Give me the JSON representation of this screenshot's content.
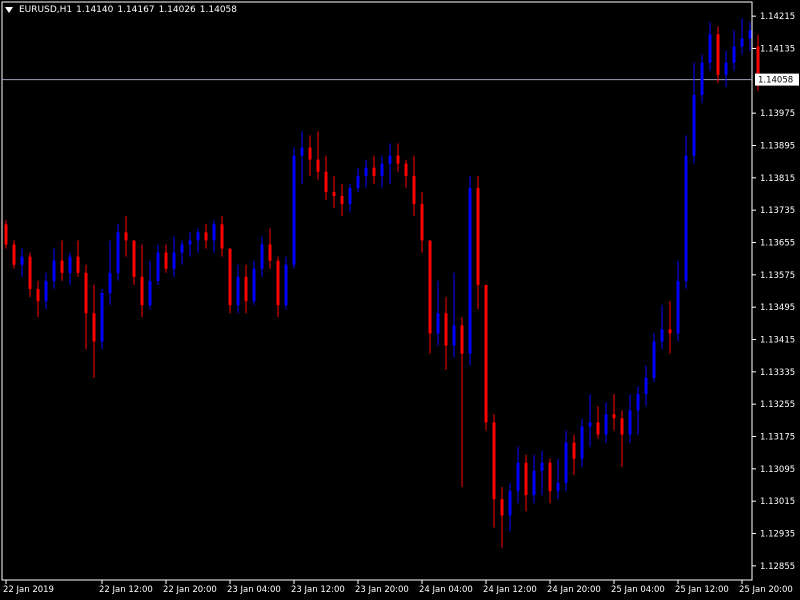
{
  "header": {
    "symbol": "EURUSD,H1",
    "open": "1.14140",
    "high": "1.14167",
    "low": "1.14026",
    "close": "1.14058"
  },
  "colors": {
    "background": "#000000",
    "bull": "#0000ff",
    "bear": "#ff0000",
    "axis": "#ffffff",
    "current_line": "#a0a0c0"
  },
  "chart_data": {
    "type": "candlestick",
    "symbol": "EURUSD",
    "timeframe": "H1",
    "ylim": [
      1.1282,
      1.1425
    ],
    "yticks": [
      "1.14215",
      "1.14135",
      "1.14058",
      "1.13975",
      "1.13895",
      "1.13815",
      "1.13735",
      "1.13655",
      "1.13575",
      "1.13495",
      "1.13415",
      "1.13335",
      "1.13255",
      "1.13175",
      "1.13095",
      "1.13015",
      "1.12935",
      "1.12855"
    ],
    "current_price": "1.14058",
    "xticks": [
      {
        "label": "22 Jan 2019",
        "index": 0
      },
      {
        "label": "22 Jan 12:00",
        "index": 12
      },
      {
        "label": "22 Jan 20:00",
        "index": 20
      },
      {
        "label": "23 Jan 04:00",
        "index": 28
      },
      {
        "label": "23 Jan 12:00",
        "index": 36
      },
      {
        "label": "23 Jan 20:00",
        "index": 44
      },
      {
        "label": "24 Jan 04:00",
        "index": 52
      },
      {
        "label": "24 Jan 12:00",
        "index": 60
      },
      {
        "label": "24 Jan 20:00",
        "index": 68
      },
      {
        "label": "25 Jan 04:00",
        "index": 76
      },
      {
        "label": "25 Jan 12:00",
        "index": 84
      },
      {
        "label": "25 Jan 20:00",
        "index": 92
      }
    ],
    "candles": [
      [
        1.137,
        1.1371,
        1.1364,
        1.1365
      ],
      [
        1.1365,
        1.1366,
        1.1359,
        1.136
      ],
      [
        1.136,
        1.1364,
        1.1357,
        1.1362
      ],
      [
        1.1362,
        1.1363,
        1.1352,
        1.1354
      ],
      [
        1.1354,
        1.1356,
        1.1347,
        1.1351
      ],
      [
        1.1351,
        1.1358,
        1.1349,
        1.1356
      ],
      [
        1.1356,
        1.1364,
        1.1354,
        1.1361
      ],
      [
        1.1361,
        1.1366,
        1.1356,
        1.1358
      ],
      [
        1.1358,
        1.1363,
        1.1355,
        1.1362
      ],
      [
        1.1362,
        1.1366,
        1.1357,
        1.1358
      ],
      [
        1.1358,
        1.136,
        1.1339,
        1.1348
      ],
      [
        1.1348,
        1.1355,
        1.1332,
        1.1341
      ],
      [
        1.1341,
        1.1354,
        1.1339,
        1.1353
      ],
      [
        1.1353,
        1.1366,
        1.135,
        1.1358
      ],
      [
        1.1358,
        1.137,
        1.1356,
        1.1368
      ],
      [
        1.1368,
        1.1372,
        1.1362,
        1.1366
      ],
      [
        1.1366,
        1.1366,
        1.1355,
        1.1357
      ],
      [
        1.1357,
        1.1365,
        1.1347,
        1.135
      ],
      [
        1.135,
        1.1361,
        1.1349,
        1.1356
      ],
      [
        1.1356,
        1.1365,
        1.1355,
        1.1363
      ],
      [
        1.1363,
        1.1365,
        1.1358,
        1.1359
      ],
      [
        1.1359,
        1.1367,
        1.1357,
        1.1363
      ],
      [
        1.1363,
        1.1366,
        1.136,
        1.1365
      ],
      [
        1.1365,
        1.1368,
        1.1362,
        1.1366
      ],
      [
        1.1366,
        1.1369,
        1.1363,
        1.1368
      ],
      [
        1.1368,
        1.137,
        1.1364,
        1.1366
      ],
      [
        1.1366,
        1.1371,
        1.1363,
        1.137
      ],
      [
        1.137,
        1.1372,
        1.1362,
        1.1364
      ],
      [
        1.1364,
        1.1364,
        1.1348,
        1.135
      ],
      [
        1.135,
        1.136,
        1.1348,
        1.1357
      ],
      [
        1.1357,
        1.136,
        1.1348,
        1.1351
      ],
      [
        1.1351,
        1.1361,
        1.135,
        1.1359
      ],
      [
        1.1359,
        1.1367,
        1.1357,
        1.1365
      ],
      [
        1.1365,
        1.1369,
        1.1359,
        1.1361
      ],
      [
        1.1361,
        1.1362,
        1.1347,
        1.135
      ],
      [
        1.135,
        1.1362,
        1.1349,
        1.136
      ],
      [
        1.136,
        1.1389,
        1.1359,
        1.1387
      ],
      [
        1.1387,
        1.1393,
        1.138,
        1.1389
      ],
      [
        1.1389,
        1.1392,
        1.1382,
        1.1386
      ],
      [
        1.1386,
        1.1393,
        1.1381,
        1.1383
      ],
      [
        1.1383,
        1.1387,
        1.1376,
        1.1378
      ],
      [
        1.1378,
        1.1382,
        1.1374,
        1.1377
      ],
      [
        1.1377,
        1.138,
        1.1372,
        1.1375
      ],
      [
        1.1375,
        1.138,
        1.1373,
        1.1379
      ],
      [
        1.1379,
        1.1384,
        1.1378,
        1.1382
      ],
      [
        1.1382,
        1.1386,
        1.1379,
        1.1384
      ],
      [
        1.1384,
        1.1387,
        1.138,
        1.1382
      ],
      [
        1.1382,
        1.1387,
        1.1379,
        1.1385
      ],
      [
        1.1385,
        1.139,
        1.138,
        1.1387
      ],
      [
        1.1387,
        1.139,
        1.1383,
        1.1385
      ],
      [
        1.1385,
        1.1386,
        1.1379,
        1.1382
      ],
      [
        1.1382,
        1.1387,
        1.1372,
        1.1375
      ],
      [
        1.1375,
        1.1378,
        1.1363,
        1.1366
      ],
      [
        1.1366,
        1.1366,
        1.1338,
        1.1343
      ],
      [
        1.1343,
        1.1356,
        1.134,
        1.1348
      ],
      [
        1.1348,
        1.1352,
        1.1334,
        1.134
      ],
      [
        1.134,
        1.1358,
        1.1337,
        1.1345
      ],
      [
        1.1345,
        1.1347,
        1.1305,
        1.1338
      ],
      [
        1.1338,
        1.1382,
        1.1335,
        1.1379
      ],
      [
        1.1379,
        1.1382,
        1.1349,
        1.1355
      ],
      [
        1.1355,
        1.1355,
        1.1319,
        1.1321
      ],
      [
        1.1321,
        1.1323,
        1.1295,
        1.1302
      ],
      [
        1.1302,
        1.1305,
        1.129,
        1.1298
      ],
      [
        1.1298,
        1.1306,
        1.1294,
        1.1304
      ],
      [
        1.1304,
        1.1315,
        1.1301,
        1.1311
      ],
      [
        1.1311,
        1.1313,
        1.1299,
        1.1303
      ],
      [
        1.1303,
        1.1313,
        1.1301,
        1.1309
      ],
      [
        1.1309,
        1.1314,
        1.1303,
        1.1311
      ],
      [
        1.1311,
        1.1312,
        1.1301,
        1.1304
      ],
      [
        1.1304,
        1.1312,
        1.1302,
        1.1306
      ],
      [
        1.1306,
        1.1319,
        1.1304,
        1.1316
      ],
      [
        1.1316,
        1.1318,
        1.1308,
        1.1312
      ],
      [
        1.1312,
        1.1322,
        1.131,
        1.132
      ],
      [
        1.132,
        1.1328,
        1.1315,
        1.1321
      ],
      [
        1.1321,
        1.1325,
        1.1317,
        1.1318
      ],
      [
        1.1318,
        1.1326,
        1.1316,
        1.1323
      ],
      [
        1.1323,
        1.1328,
        1.1319,
        1.1322
      ],
      [
        1.1322,
        1.1324,
        1.131,
        1.1318
      ],
      [
        1.1318,
        1.1328,
        1.1316,
        1.1324
      ],
      [
        1.1324,
        1.133,
        1.1318,
        1.1328
      ],
      [
        1.1328,
        1.1335,
        1.1325,
        1.1332
      ],
      [
        1.1332,
        1.1343,
        1.1331,
        1.1341
      ],
      [
        1.1341,
        1.135,
        1.1339,
        1.1344
      ],
      [
        1.1344,
        1.1351,
        1.1338,
        1.1343
      ],
      [
        1.1343,
        1.1361,
        1.1341,
        1.1356
      ],
      [
        1.1356,
        1.1392,
        1.1354,
        1.1387
      ],
      [
        1.1387,
        1.141,
        1.1385,
        1.1402
      ],
      [
        1.1402,
        1.1412,
        1.14,
        1.141
      ],
      [
        1.141,
        1.142,
        1.1408,
        1.1417
      ],
      [
        1.1417,
        1.1419,
        1.1405,
        1.1407
      ],
      [
        1.1407,
        1.1413,
        1.1404,
        1.141
      ],
      [
        1.141,
        1.1418,
        1.1408,
        1.1414
      ],
      [
        1.1414,
        1.1421,
        1.1412,
        1.1416
      ],
      [
        1.1416,
        1.142,
        1.1413,
        1.1418
      ],
      [
        1.1414,
        1.1417,
        1.1403,
        1.1406
      ]
    ]
  }
}
